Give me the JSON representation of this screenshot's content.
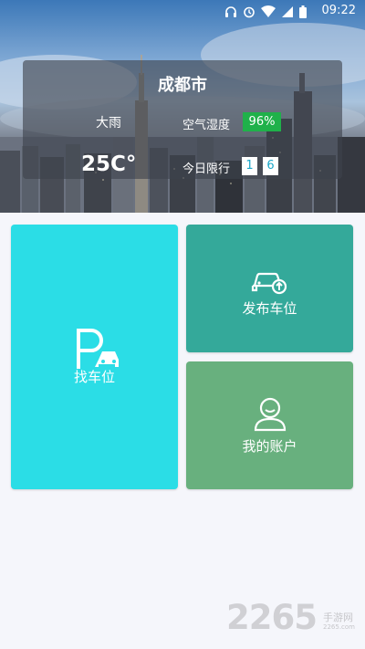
{
  "status_bar": {
    "time": "09:22",
    "icons": [
      "headset-icon",
      "alarm-icon",
      "wifi-icon",
      "signal-icon",
      "battery-icon"
    ]
  },
  "weather": {
    "city": "成都市",
    "condition": "大雨",
    "temperature": "25C°",
    "humidity_label": "空气湿度",
    "humidity_value": "96%",
    "restriction_label": "今日限行",
    "restriction_numbers": [
      "1",
      "6"
    ]
  },
  "tiles": {
    "find_parking": "找车位",
    "publish_parking": "发布车位",
    "my_account": "我的账户"
  },
  "watermark": {
    "number": "2265",
    "name": "手游网",
    "domain": "2265.com"
  },
  "colors": {
    "find_tile": "#2bdde6",
    "publish_tile": "#34a99a",
    "account_tile": "#68b07e",
    "humidity_badge": "#1fb14a",
    "restriction_number_text": "#1aa7c9"
  }
}
